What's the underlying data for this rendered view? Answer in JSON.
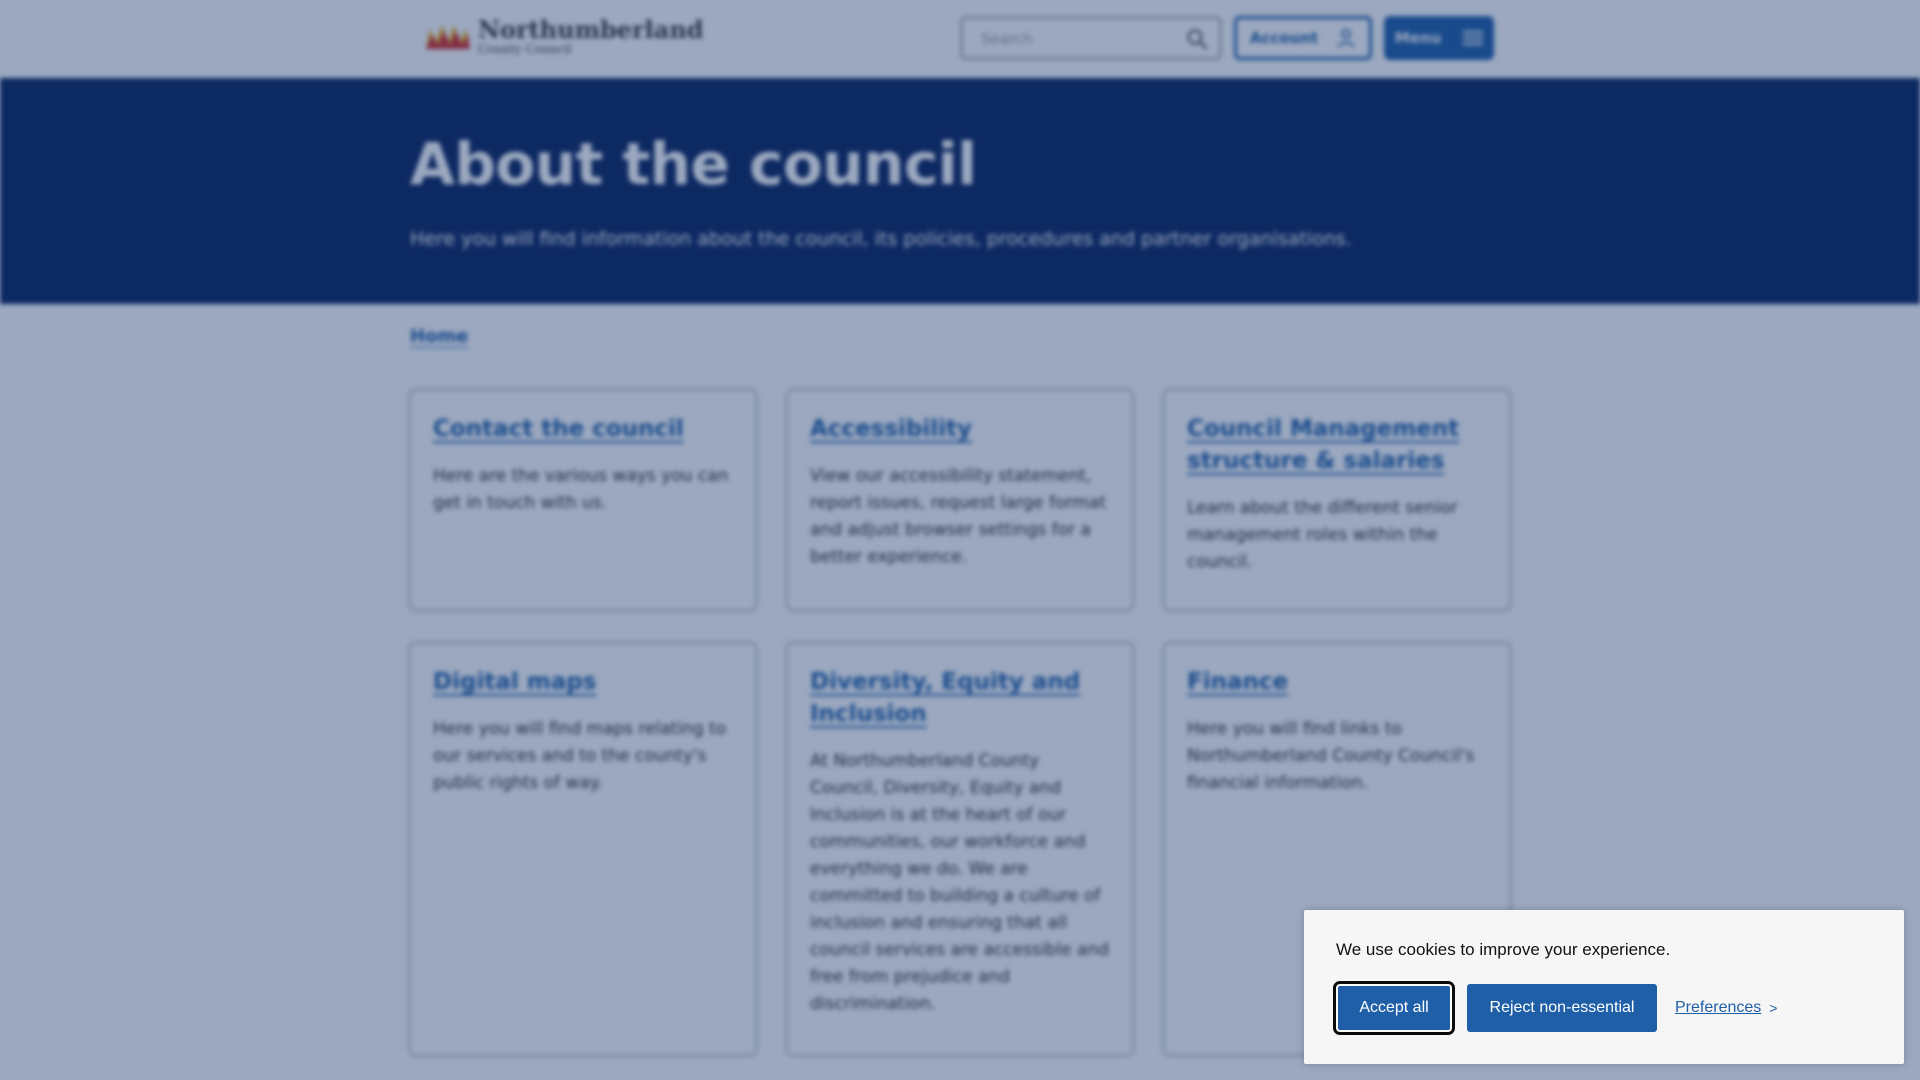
{
  "header": {
    "logo_name": "Northumberland",
    "logo_subtitle": "County Council",
    "search_placeholder": "Search",
    "account_label": "Account",
    "menu_label": "Menu"
  },
  "hero": {
    "title": "About the council",
    "description": "Here you will find information about the council, its policies, procedures and partner organisations."
  },
  "breadcrumb": {
    "home": "Home"
  },
  "cards": [
    {
      "title": "Contact the council",
      "text": "Here are the various ways you can get in touch with us."
    },
    {
      "title": "Accessibility",
      "text": "View our accessibility statement, report issues, request large format and adjust browser settings for a better experience."
    },
    {
      "title": "Council Management structure & salaries",
      "text": "Learn about the different senior management roles within the council."
    },
    {
      "title": "Digital maps",
      "text": "Here you will find maps relating to our services and to the county's public rights of way."
    },
    {
      "title": "Diversity, Equity and Inclusion",
      "text": "At Northumberland County Council, Diversity, Equity and Inclusion is at the heart of our communities, our workforce and everything we do. We are committed to building a culture of inclusion and ensuring that all council services are accessible and free from prejudice and discrimination."
    },
    {
      "title": "Finance",
      "text": "Here you will find links to Northumberland County Council's financial information."
    }
  ],
  "cookie": {
    "message": "We use cookies to improve your experience.",
    "accept_label": "Accept all",
    "reject_label": "Reject non-essential",
    "preferences_label": "Preferences",
    "preferences_chevron": ">"
  },
  "colors": {
    "brand_blue": "#1f5fa8",
    "hero_navy": "#0b2560",
    "logo_red": "#d62b2b",
    "logo_yellow": "#f3b61f"
  }
}
